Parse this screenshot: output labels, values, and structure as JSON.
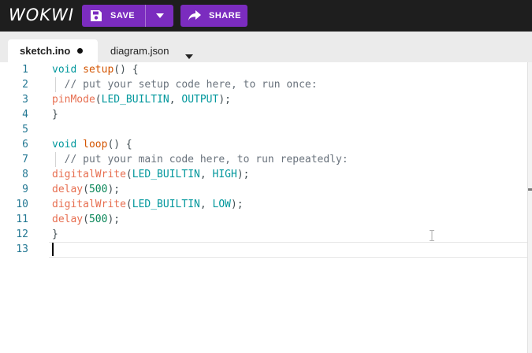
{
  "header": {
    "logo": "WOKWI",
    "save_label": "SAVE",
    "share_label": "SHARE"
  },
  "tabs": [
    {
      "label": "sketch.ino",
      "active": true,
      "modified": true
    },
    {
      "label": "diagram.json",
      "active": false
    }
  ],
  "editor": {
    "line_numbers": [
      "1",
      "2",
      "3",
      "4",
      "5",
      "6",
      "7",
      "8",
      "9",
      "10",
      "11",
      "12",
      "13"
    ],
    "lines": [
      [
        {
          "t": "void ",
          "c": "kw"
        },
        {
          "t": "setup",
          "c": "fn"
        },
        {
          "t": "() {",
          "c": "punct"
        }
      ],
      [
        {
          "t": "  // put your setup code here, to run once:",
          "c": "cmt"
        }
      ],
      [
        {
          "t": "pinMode",
          "c": "fnr"
        },
        {
          "t": "(",
          "c": "punct"
        },
        {
          "t": "LED_BUILTIN",
          "c": "const"
        },
        {
          "t": ", ",
          "c": "punct"
        },
        {
          "t": "OUTPUT",
          "c": "const"
        },
        {
          "t": ");",
          "c": "punct"
        }
      ],
      [
        {
          "t": "}",
          "c": "punct"
        }
      ],
      [],
      [
        {
          "t": "void ",
          "c": "kw"
        },
        {
          "t": "loop",
          "c": "fn"
        },
        {
          "t": "() {",
          "c": "punct"
        }
      ],
      [
        {
          "t": "  // put your main code here, to run repeatedly:",
          "c": "cmt"
        }
      ],
      [
        {
          "t": "digitalWrite",
          "c": "fnr"
        },
        {
          "t": "(",
          "c": "punct"
        },
        {
          "t": "LED_BUILTIN",
          "c": "const"
        },
        {
          "t": ", ",
          "c": "punct"
        },
        {
          "t": "HIGH",
          "c": "const"
        },
        {
          "t": ");",
          "c": "punct"
        }
      ],
      [
        {
          "t": "delay",
          "c": "fnr"
        },
        {
          "t": "(",
          "c": "punct"
        },
        {
          "t": "500",
          "c": "num"
        },
        {
          "t": ");",
          "c": "punct"
        }
      ],
      [
        {
          "t": "digitalWrite",
          "c": "fnr"
        },
        {
          "t": "(",
          "c": "punct"
        },
        {
          "t": "LED_BUILTIN",
          "c": "const"
        },
        {
          "t": ", ",
          "c": "punct"
        },
        {
          "t": "LOW",
          "c": "const"
        },
        {
          "t": ");",
          "c": "punct"
        }
      ],
      [
        {
          "t": "delay",
          "c": "fnr"
        },
        {
          "t": "(",
          "c": "punct"
        },
        {
          "t": "500",
          "c": "num"
        },
        {
          "t": ");",
          "c": "punct"
        }
      ],
      [
        {
          "t": "}",
          "c": "punct"
        }
      ],
      []
    ]
  },
  "icons": {
    "save": "save-icon",
    "dropdown": "chevron-down-icon",
    "share": "share-icon",
    "tab_menu": "triangle-down-icon"
  },
  "colors": {
    "accent": "#7b2cbf",
    "topbar": "#1e1e1e",
    "tabbar": "#ebebeb"
  }
}
